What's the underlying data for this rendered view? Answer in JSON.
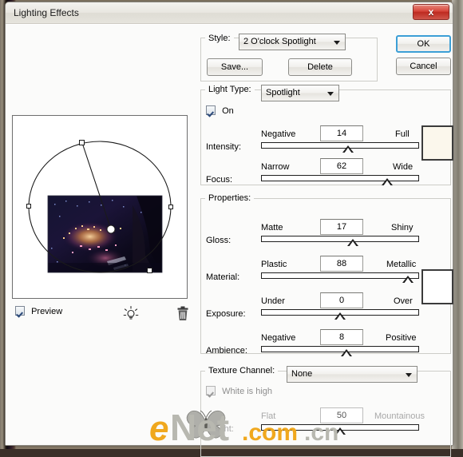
{
  "window": {
    "title": "Lighting Effects",
    "close_icon": "close-icon",
    "close_label": "x"
  },
  "preview": {
    "checkbox_label": "Preview",
    "checked": true,
    "bulb_icon": "light-bulb-icon",
    "trash_icon": "trash-icon",
    "thumbnail_alt": "dark tunnel night scene"
  },
  "style_group": {
    "legend": "Style:",
    "selected": "2 O'clock Spotlight",
    "save_label": "Save...",
    "delete_label": "Delete"
  },
  "actions": {
    "ok_label": "OK",
    "cancel_label": "Cancel"
  },
  "light_type_group": {
    "legend": "Light Type:",
    "selected": "Spotlight",
    "on_label": "On",
    "on_checked": true,
    "intensity": {
      "label": "Intensity:",
      "min_label": "Negative",
      "max_label": "Full",
      "value": "14",
      "percent": 55
    },
    "focus": {
      "label": "Focus:",
      "min_label": "Narrow",
      "max_label": "Wide",
      "value": "62",
      "percent": 80
    },
    "color_swatch": "#fbf7ec"
  },
  "properties_group": {
    "legend": "Properties:",
    "gloss": {
      "label": "Gloss:",
      "min_label": "Matte",
      "max_label": "Shiny",
      "value": "17",
      "percent": 58
    },
    "material": {
      "label": "Material:",
      "min_label": "Plastic",
      "max_label": "Metallic",
      "value": "88",
      "percent": 93
    },
    "exposure": {
      "label": "Exposure:",
      "min_label": "Under",
      "max_label": "Over",
      "value": "0",
      "percent": 50
    },
    "ambience": {
      "label": "Ambience:",
      "min_label": "Negative",
      "max_label": "Positive",
      "value": "8",
      "percent": 54
    },
    "color_swatch": "#ffffff"
  },
  "texture_group": {
    "legend": "Texture Channel:",
    "selected": "None",
    "white_is_high_label": "White is high",
    "white_is_high_checked": true,
    "white_is_high_enabled": false,
    "height": {
      "label": "Height:",
      "min_label": "Flat",
      "max_label": "Mountainous",
      "value": "50",
      "percent": 50,
      "enabled": false
    }
  },
  "watermark": {
    "e": "e",
    "net": "Net",
    "com": ".com",
    "cn": ".cn",
    "color_gold": "#f0a81e",
    "color_gray": "#b8b8b0"
  }
}
